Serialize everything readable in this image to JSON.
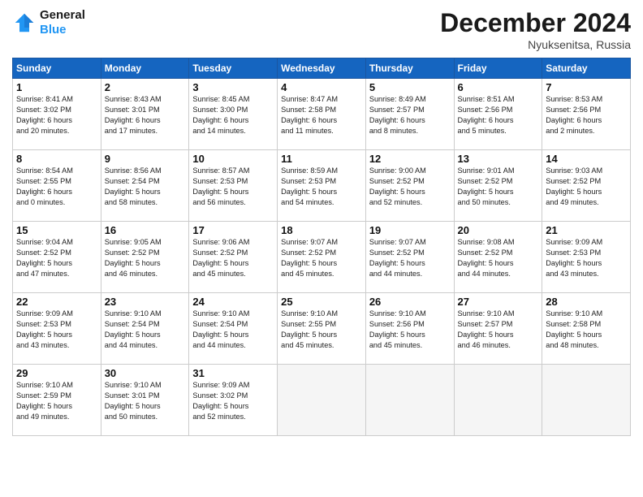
{
  "header": {
    "logo_line1": "General",
    "logo_line2": "Blue",
    "month": "December 2024",
    "location": "Nyuksenitsa, Russia"
  },
  "weekdays": [
    "Sunday",
    "Monday",
    "Tuesday",
    "Wednesday",
    "Thursday",
    "Friday",
    "Saturday"
  ],
  "weeks": [
    [
      {
        "day": "1",
        "lines": [
          "Sunrise: 8:41 AM",
          "Sunset: 3:02 PM",
          "Daylight: 6 hours",
          "and 20 minutes."
        ]
      },
      {
        "day": "2",
        "lines": [
          "Sunrise: 8:43 AM",
          "Sunset: 3:01 PM",
          "Daylight: 6 hours",
          "and 17 minutes."
        ]
      },
      {
        "day": "3",
        "lines": [
          "Sunrise: 8:45 AM",
          "Sunset: 3:00 PM",
          "Daylight: 6 hours",
          "and 14 minutes."
        ]
      },
      {
        "day": "4",
        "lines": [
          "Sunrise: 8:47 AM",
          "Sunset: 2:58 PM",
          "Daylight: 6 hours",
          "and 11 minutes."
        ]
      },
      {
        "day": "5",
        "lines": [
          "Sunrise: 8:49 AM",
          "Sunset: 2:57 PM",
          "Daylight: 6 hours",
          "and 8 minutes."
        ]
      },
      {
        "day": "6",
        "lines": [
          "Sunrise: 8:51 AM",
          "Sunset: 2:56 PM",
          "Daylight: 6 hours",
          "and 5 minutes."
        ]
      },
      {
        "day": "7",
        "lines": [
          "Sunrise: 8:53 AM",
          "Sunset: 2:56 PM",
          "Daylight: 6 hours",
          "and 2 minutes."
        ]
      }
    ],
    [
      {
        "day": "8",
        "lines": [
          "Sunrise: 8:54 AM",
          "Sunset: 2:55 PM",
          "Daylight: 6 hours",
          "and 0 minutes."
        ]
      },
      {
        "day": "9",
        "lines": [
          "Sunrise: 8:56 AM",
          "Sunset: 2:54 PM",
          "Daylight: 5 hours",
          "and 58 minutes."
        ]
      },
      {
        "day": "10",
        "lines": [
          "Sunrise: 8:57 AM",
          "Sunset: 2:53 PM",
          "Daylight: 5 hours",
          "and 56 minutes."
        ]
      },
      {
        "day": "11",
        "lines": [
          "Sunrise: 8:59 AM",
          "Sunset: 2:53 PM",
          "Daylight: 5 hours",
          "and 54 minutes."
        ]
      },
      {
        "day": "12",
        "lines": [
          "Sunrise: 9:00 AM",
          "Sunset: 2:52 PM",
          "Daylight: 5 hours",
          "and 52 minutes."
        ]
      },
      {
        "day": "13",
        "lines": [
          "Sunrise: 9:01 AM",
          "Sunset: 2:52 PM",
          "Daylight: 5 hours",
          "and 50 minutes."
        ]
      },
      {
        "day": "14",
        "lines": [
          "Sunrise: 9:03 AM",
          "Sunset: 2:52 PM",
          "Daylight: 5 hours",
          "and 49 minutes."
        ]
      }
    ],
    [
      {
        "day": "15",
        "lines": [
          "Sunrise: 9:04 AM",
          "Sunset: 2:52 PM",
          "Daylight: 5 hours",
          "and 47 minutes."
        ]
      },
      {
        "day": "16",
        "lines": [
          "Sunrise: 9:05 AM",
          "Sunset: 2:52 PM",
          "Daylight: 5 hours",
          "and 46 minutes."
        ]
      },
      {
        "day": "17",
        "lines": [
          "Sunrise: 9:06 AM",
          "Sunset: 2:52 PM",
          "Daylight: 5 hours",
          "and 45 minutes."
        ]
      },
      {
        "day": "18",
        "lines": [
          "Sunrise: 9:07 AM",
          "Sunset: 2:52 PM",
          "Daylight: 5 hours",
          "and 45 minutes."
        ]
      },
      {
        "day": "19",
        "lines": [
          "Sunrise: 9:07 AM",
          "Sunset: 2:52 PM",
          "Daylight: 5 hours",
          "and 44 minutes."
        ]
      },
      {
        "day": "20",
        "lines": [
          "Sunrise: 9:08 AM",
          "Sunset: 2:52 PM",
          "Daylight: 5 hours",
          "and 44 minutes."
        ]
      },
      {
        "day": "21",
        "lines": [
          "Sunrise: 9:09 AM",
          "Sunset: 2:53 PM",
          "Daylight: 5 hours",
          "and 43 minutes."
        ]
      }
    ],
    [
      {
        "day": "22",
        "lines": [
          "Sunrise: 9:09 AM",
          "Sunset: 2:53 PM",
          "Daylight: 5 hours",
          "and 43 minutes."
        ]
      },
      {
        "day": "23",
        "lines": [
          "Sunrise: 9:10 AM",
          "Sunset: 2:54 PM",
          "Daylight: 5 hours",
          "and 44 minutes."
        ]
      },
      {
        "day": "24",
        "lines": [
          "Sunrise: 9:10 AM",
          "Sunset: 2:54 PM",
          "Daylight: 5 hours",
          "and 44 minutes."
        ]
      },
      {
        "day": "25",
        "lines": [
          "Sunrise: 9:10 AM",
          "Sunset: 2:55 PM",
          "Daylight: 5 hours",
          "and 45 minutes."
        ]
      },
      {
        "day": "26",
        "lines": [
          "Sunrise: 9:10 AM",
          "Sunset: 2:56 PM",
          "Daylight: 5 hours",
          "and 45 minutes."
        ]
      },
      {
        "day": "27",
        "lines": [
          "Sunrise: 9:10 AM",
          "Sunset: 2:57 PM",
          "Daylight: 5 hours",
          "and 46 minutes."
        ]
      },
      {
        "day": "28",
        "lines": [
          "Sunrise: 9:10 AM",
          "Sunset: 2:58 PM",
          "Daylight: 5 hours",
          "and 48 minutes."
        ]
      }
    ],
    [
      {
        "day": "29",
        "lines": [
          "Sunrise: 9:10 AM",
          "Sunset: 2:59 PM",
          "Daylight: 5 hours",
          "and 49 minutes."
        ]
      },
      {
        "day": "30",
        "lines": [
          "Sunrise: 9:10 AM",
          "Sunset: 3:01 PM",
          "Daylight: 5 hours",
          "and 50 minutes."
        ]
      },
      {
        "day": "31",
        "lines": [
          "Sunrise: 9:09 AM",
          "Sunset: 3:02 PM",
          "Daylight: 5 hours",
          "and 52 minutes."
        ]
      },
      null,
      null,
      null,
      null
    ]
  ]
}
